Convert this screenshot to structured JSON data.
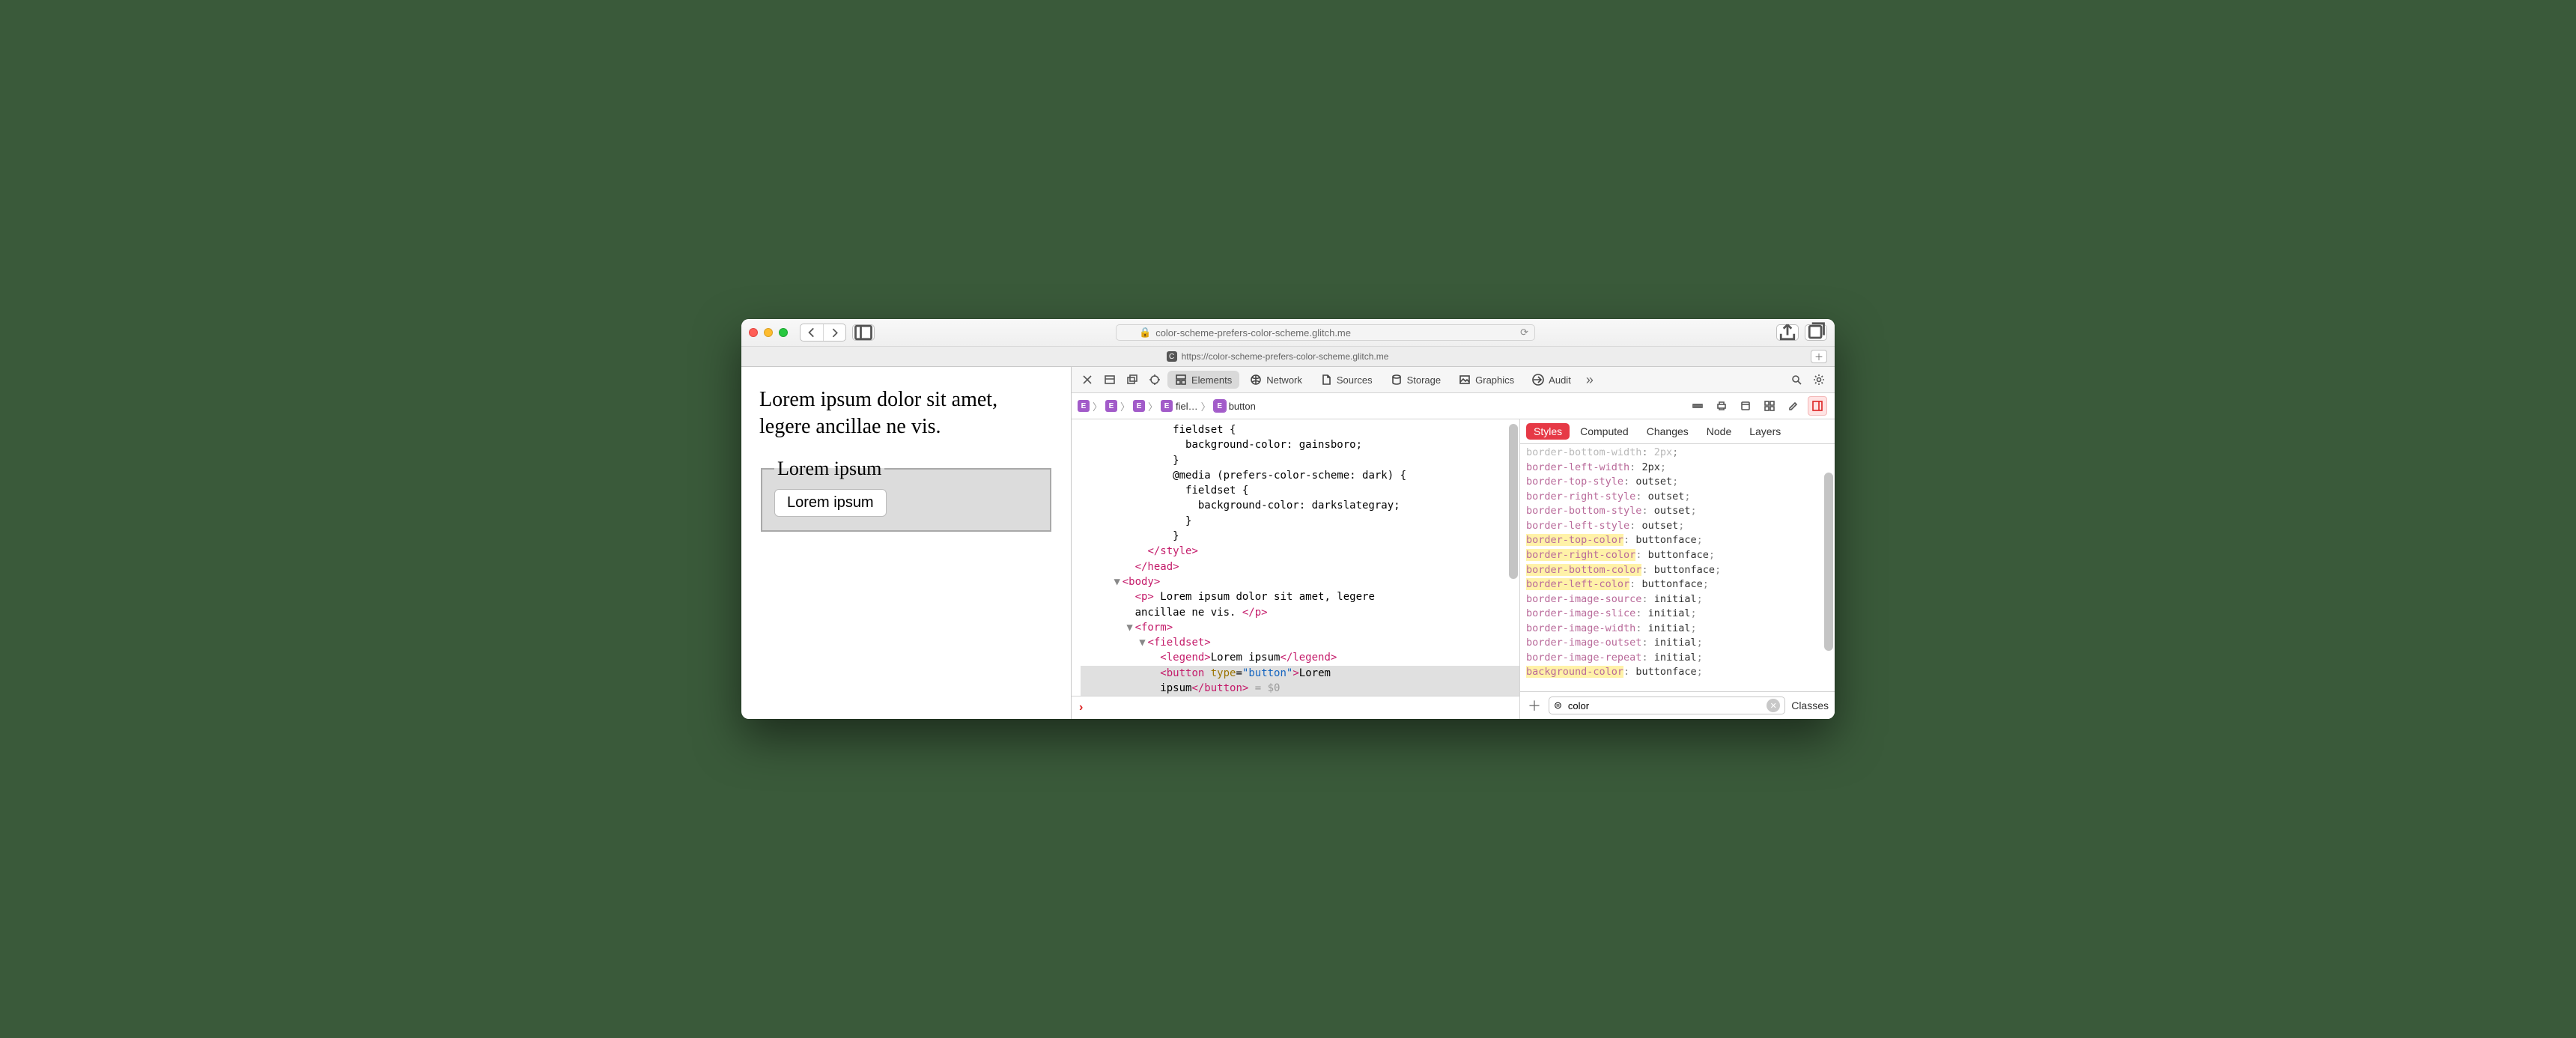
{
  "browser": {
    "address_display": "color-scheme-prefers-color-scheme.glitch.me",
    "tab_url": "https://color-scheme-prefers-color-scheme.glitch.me",
    "tab_favicon_letter": "C"
  },
  "page": {
    "paragraph": "Lorem ipsum dolor sit amet, legere ancillae ne vis.",
    "legend": "Lorem ipsum",
    "button_label": "Lorem ipsum"
  },
  "devtools": {
    "tabs": {
      "elements": "Elements",
      "network": "Network",
      "sources": "Sources",
      "storage": "Storage",
      "graphics": "Graphics",
      "audit": "Audit"
    },
    "breadcrumbs": [
      {
        "badge": "E",
        "label": ""
      },
      {
        "badge": "E",
        "label": ""
      },
      {
        "badge": "E",
        "label": ""
      },
      {
        "badge": "E",
        "label": "fiel…"
      },
      {
        "badge": "E",
        "label": "button"
      }
    ],
    "dom_lines": [
      {
        "indent": 7,
        "html": "fieldset {"
      },
      {
        "indent": 8,
        "html": "background-color: gainsboro;"
      },
      {
        "indent": 7,
        "html": "}"
      },
      {
        "indent": 7,
        "html": "@media (prefers-color-scheme: dark) {"
      },
      {
        "indent": 8,
        "html": "fieldset {"
      },
      {
        "indent": 9,
        "html": "background-color: darkslategray;"
      },
      {
        "indent": 8,
        "html": "}"
      },
      {
        "indent": 7,
        "html": "}"
      },
      {
        "indent": 5,
        "html": "<span class='t-tag'>&lt;/style&gt;</span>"
      },
      {
        "indent": 4,
        "html": "<span class='t-tag'>&lt;/head&gt;</span>"
      },
      {
        "indent": 3,
        "disc": "▼",
        "html": "<span class='t-tag'>&lt;body&gt;</span>"
      },
      {
        "indent": 4,
        "html": "<span class='t-tag'>&lt;p&gt;</span> Lorem ipsum dolor sit amet, legere"
      },
      {
        "indent": 4,
        "html": "ancillae ne vis. <span class='t-tag'>&lt;/p&gt;</span>"
      },
      {
        "indent": 4,
        "disc": "▼",
        "html": "<span class='t-tag'>&lt;form&gt;</span>"
      },
      {
        "indent": 5,
        "disc": "▼",
        "html": "<span class='t-tag'>&lt;fieldset&gt;</span>"
      },
      {
        "indent": 6,
        "html": "<span class='t-tag'>&lt;legend&gt;</span>Lorem ipsum<span class='t-tag'>&lt;/legend&gt;</span>"
      },
      {
        "indent": 6,
        "hl": true,
        "html": "<span class='t-tag'>&lt;button</span> <span class='t-attr'>type</span>=<span class='t-val'>\"button\"</span><span class='t-tag'>&gt;</span>Lorem"
      },
      {
        "indent": 6,
        "hl": true,
        "html": "ipsum<span class='t-tag'>&lt;/button&gt;</span> <span class='t-gray'>= $0</span>"
      }
    ],
    "styles": {
      "tabs": {
        "styles": "Styles",
        "computed": "Computed",
        "changes": "Changes",
        "node": "Node",
        "layers": "Layers"
      },
      "props": [
        {
          "name": "border-bottom-width",
          "value": "2px",
          "strike": true
        },
        {
          "name": "border-left-width",
          "value": "2px"
        },
        {
          "name": "border-top-style",
          "value": "outset"
        },
        {
          "name": "border-right-style",
          "value": "outset"
        },
        {
          "name": "border-bottom-style",
          "value": "outset"
        },
        {
          "name": "border-left-style",
          "value": "outset"
        },
        {
          "name": "border-top-color",
          "value": "buttonface",
          "hl": true
        },
        {
          "name": "border-right-color",
          "value": "buttonface",
          "hl": true
        },
        {
          "name": "border-bottom-color",
          "value": "buttonface",
          "hl": true
        },
        {
          "name": "border-left-color",
          "value": "buttonface",
          "hl": true
        },
        {
          "name": "border-image-source",
          "value": "initial"
        },
        {
          "name": "border-image-slice",
          "value": "initial"
        },
        {
          "name": "border-image-width",
          "value": "initial"
        },
        {
          "name": "border-image-outset",
          "value": "initial"
        },
        {
          "name": "border-image-repeat",
          "value": "initial"
        },
        {
          "name": "background-color",
          "value": "buttonface",
          "hl": true
        }
      ],
      "filter_value": "color",
      "classes_label": "Classes"
    }
  }
}
